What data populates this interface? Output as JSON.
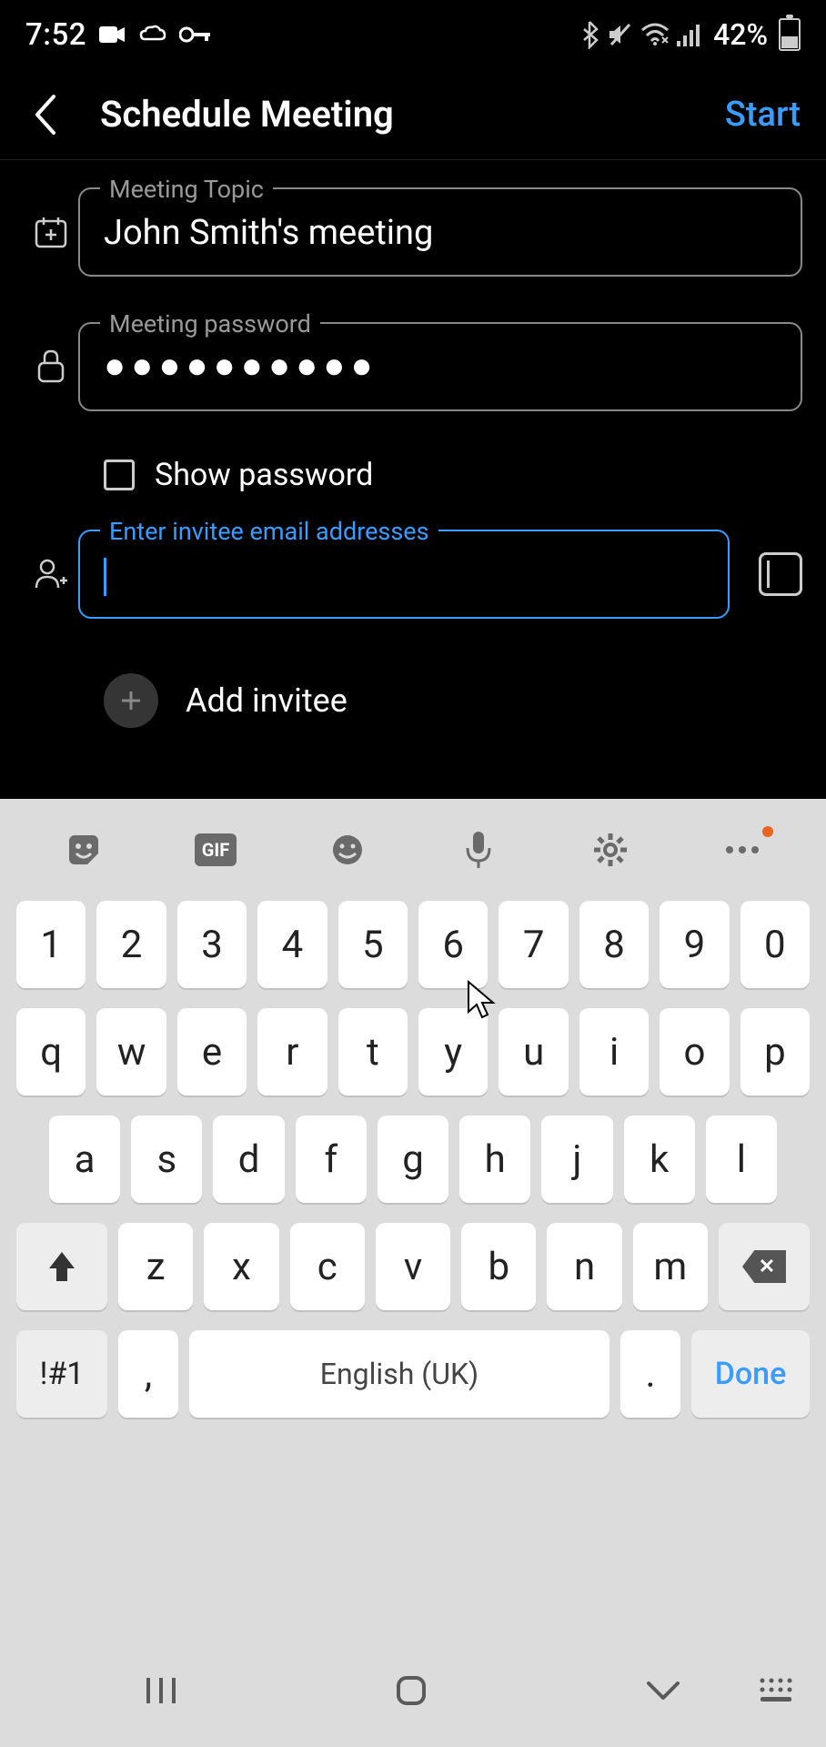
{
  "status": {
    "time": "7:52",
    "battery": "42%"
  },
  "header": {
    "title": "Schedule Meeting",
    "action": "Start"
  },
  "form": {
    "topic_label": "Meeting Topic",
    "topic_value": "John Smith's meeting",
    "password_label": "Meeting password",
    "password_value": "●●●●●●●●●●",
    "show_password_label": "Show password",
    "invitee_label": "Enter invitee email addresses",
    "invitee_value": "",
    "add_invitee_label": "Add invitee"
  },
  "keyboard": {
    "row1": [
      "1",
      "2",
      "3",
      "4",
      "5",
      "6",
      "7",
      "8",
      "9",
      "0"
    ],
    "row2": [
      "q",
      "w",
      "e",
      "r",
      "t",
      "y",
      "u",
      "i",
      "o",
      "p"
    ],
    "row3": [
      "a",
      "s",
      "d",
      "f",
      "g",
      "h",
      "j",
      "k",
      "l"
    ],
    "row4": [
      "z",
      "x",
      "c",
      "v",
      "b",
      "n",
      "m"
    ],
    "sym": "!#1",
    "comma": ",",
    "space": "English (UK)",
    "period": ".",
    "done": "Done"
  }
}
